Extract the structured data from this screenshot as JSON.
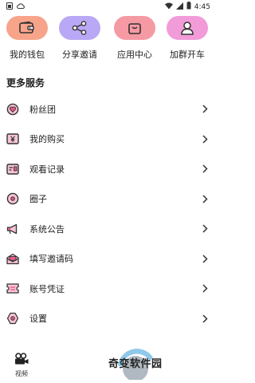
{
  "status_bar": {
    "time": "4:45",
    "left_icons": [
      "sim-icon",
      "cloud-icon"
    ],
    "right_icons": [
      "wifi-icon",
      "signal-icon",
      "battery-icon"
    ]
  },
  "quick_actions": [
    {
      "label": "我的钱包",
      "icon": "wallet-icon",
      "color": "#F7A48B"
    },
    {
      "label": "分享邀请",
      "icon": "share-icon",
      "color": "#B9A8F5"
    },
    {
      "label": "应用中心",
      "icon": "bag-icon",
      "color": "#F59AA3"
    },
    {
      "label": "加群开车",
      "icon": "group-icon",
      "color": "#F29BD9"
    }
  ],
  "more_services": {
    "title": "更多服务",
    "items": [
      {
        "label": "粉丝团",
        "icon": "heart-badge-icon"
      },
      {
        "label": "我的购买",
        "icon": "yen-card-icon"
      },
      {
        "label": "观看记录",
        "icon": "history-card-icon"
      },
      {
        "label": "圈子",
        "icon": "circle-icon"
      },
      {
        "label": "系统公告",
        "icon": "megaphone-icon"
      },
      {
        "label": "填写邀请码",
        "icon": "envelope-icon"
      },
      {
        "label": "账号凭证",
        "icon": "ticket-icon"
      },
      {
        "label": "设置",
        "icon": "settings-icon"
      }
    ]
  },
  "bottom_nav": {
    "video_label": "视频"
  },
  "watermark": {
    "text": "奇变软件园"
  },
  "colors": {
    "accent_pink": "#E85A8A",
    "icon_dark": "#333333"
  }
}
